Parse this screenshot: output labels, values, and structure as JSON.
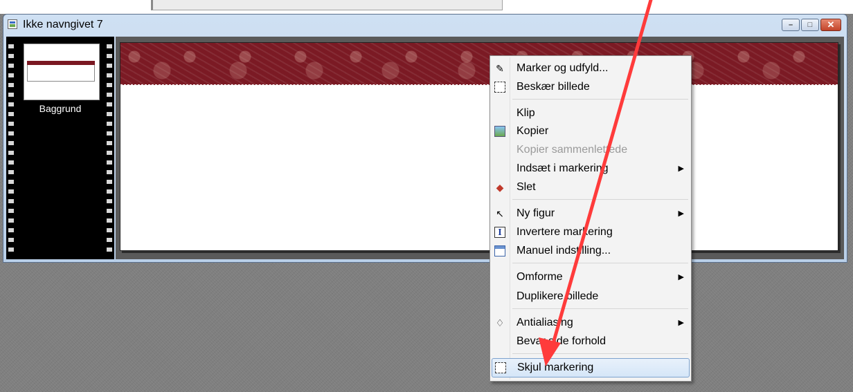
{
  "window": {
    "title": "Ikke navngivet 7",
    "buttons": {
      "minimize": "–",
      "maximize": "□",
      "close": "✕"
    }
  },
  "filmstrip": {
    "layers": [
      {
        "label": "Baggrund"
      }
    ]
  },
  "context_menu": {
    "items": [
      {
        "label": "Marker og udfyld...",
        "icon": "lasso-fill-icon"
      },
      {
        "label": "Beskær billede",
        "icon": "crop-icon"
      },
      {
        "label": "Klip",
        "icon": ""
      },
      {
        "label": "Kopier",
        "icon": "copy-image-icon"
      },
      {
        "label": "Kopier sammenlettede",
        "icon": "",
        "disabled": true
      },
      {
        "label": "Indsæt i markering",
        "icon": "",
        "submenu": true
      },
      {
        "label": "Slet",
        "icon": "eraser-icon"
      },
      {
        "label": "Ny figur",
        "icon": "pointer-icon",
        "submenu": true
      },
      {
        "label": "Invertere markering",
        "icon": "invert-selection-icon"
      },
      {
        "label": "Manuel indstilling...",
        "icon": "window-settings-icon"
      },
      {
        "label": "Omforme",
        "icon": "",
        "submenu": true
      },
      {
        "label": "Duplikere billede",
        "icon": ""
      },
      {
        "label": "Antialiasing",
        "icon": "drop-icon",
        "submenu": true
      },
      {
        "label": "Bevar side forhold",
        "icon": ""
      },
      {
        "label": "Skjul markering",
        "icon": "hide-selection-icon",
        "highlighted": true
      }
    ],
    "submenu_arrow": "▶"
  },
  "colors": {
    "banner": "#7b1a24",
    "annotation_arrow": "#ff3333",
    "menu_highlight": "#d5e6f8"
  }
}
